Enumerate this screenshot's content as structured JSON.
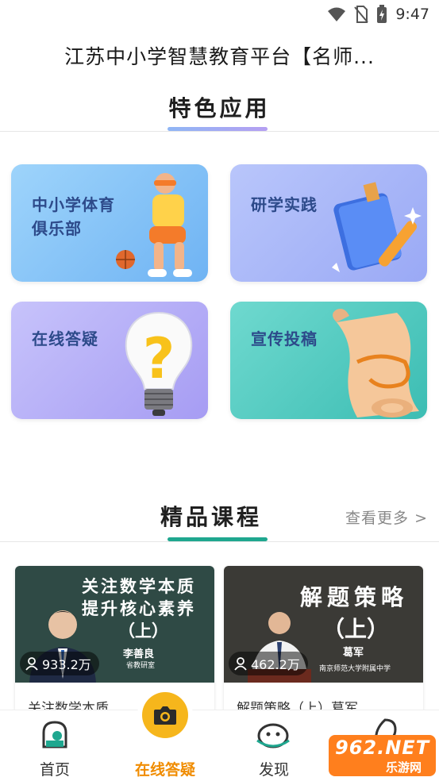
{
  "status_bar": {
    "time": "9:47"
  },
  "header": {
    "title": "江苏中小学智慧教育平台【名师..."
  },
  "featured": {
    "title": "特色应用",
    "cards": [
      {
        "line1": "中小学体育",
        "line2": "俱乐部"
      },
      {
        "line1": "研学实践"
      },
      {
        "line1": "在线答疑"
      },
      {
        "line1": "宣传投稿"
      }
    ]
  },
  "courses": {
    "title": "精品课程",
    "more": "查看更多 >",
    "items": [
      {
        "thumb_line1": "关注数学本质",
        "thumb_line2": "提升核心素养",
        "thumb_line3": "（上）",
        "teacher": "李善良",
        "teacher_note": "省教研室",
        "views": "933.2万",
        "title": "关注数学本质"
      },
      {
        "thumb_line1": "解题策略",
        "thumb_line2": "（上）",
        "teacher": "葛军",
        "teacher_note": "南京师范大学附属中学",
        "views": "462.2万",
        "title": "解题策略（上）葛军"
      }
    ]
  },
  "tabbar": {
    "items": [
      {
        "label": "首页"
      },
      {
        "label": "在线答疑",
        "active_color": "#f08c00"
      },
      {
        "label": "发现"
      }
    ]
  },
  "watermark": {
    "big": "962.NET",
    "small": "乐游网"
  },
  "colors": {
    "accent_orange": "#f6b61c",
    "accent_green": "#1fa78f"
  }
}
